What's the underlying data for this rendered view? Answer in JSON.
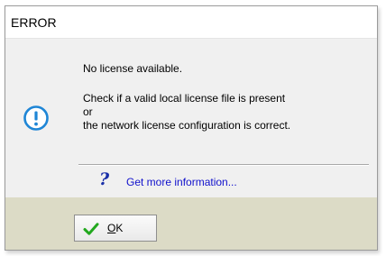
{
  "dialog": {
    "title": "ERROR",
    "messages": [
      "No license available.",
      "Check if a valid local license file is present",
      "or",
      "the network license configuration is correct."
    ],
    "status_icon": "info-icon",
    "help_icon": "question-mark-icon",
    "help_link_text": "Get more information...",
    "ok_button": {
      "icon": "checkmark-icon",
      "mnemonic": "O",
      "rest": "K"
    },
    "colors": {
      "info_icon": "#1f86d6",
      "link": "#1111cc",
      "check": "#22a81e",
      "footer": "#dcdbc6"
    }
  }
}
